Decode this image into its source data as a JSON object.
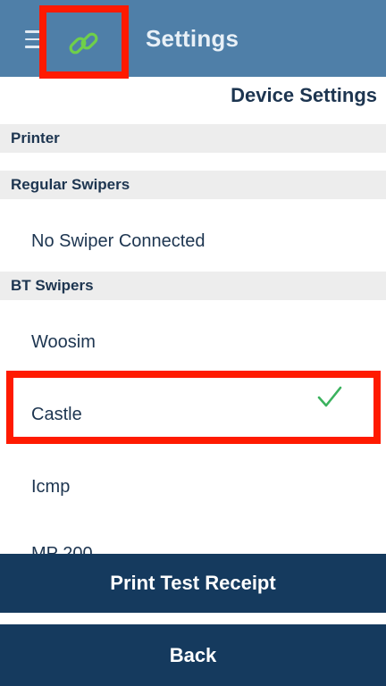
{
  "header": {
    "title": "Settings",
    "menu_icon": "hamburger-menu-icon",
    "link_icon": "link-icon",
    "link_icon_color": "#6fcf4a"
  },
  "page_heading": "Device Settings",
  "sections": {
    "printer": "Printer",
    "regular_swipers": "Regular Swipers",
    "bt_swipers": "BT Swipers"
  },
  "regular_swipers": {
    "items": [
      {
        "label": "No Swiper Connected"
      }
    ]
  },
  "bt_swipers": {
    "items": [
      {
        "label": "Woosim",
        "selected": false
      },
      {
        "label": "Castle",
        "selected": true
      },
      {
        "label": "Icmp",
        "selected": false
      },
      {
        "label": "MP 200",
        "selected": false
      }
    ]
  },
  "checkmark_color": "#3bb25e",
  "buttons": {
    "print_test_receipt": "Print Test Receipt",
    "back": "Back"
  },
  "colors": {
    "header_bg": "#4f7fa8",
    "button_bg": "#153a5e",
    "section_bg": "#ededed",
    "highlight_border": "#ff1a00"
  }
}
